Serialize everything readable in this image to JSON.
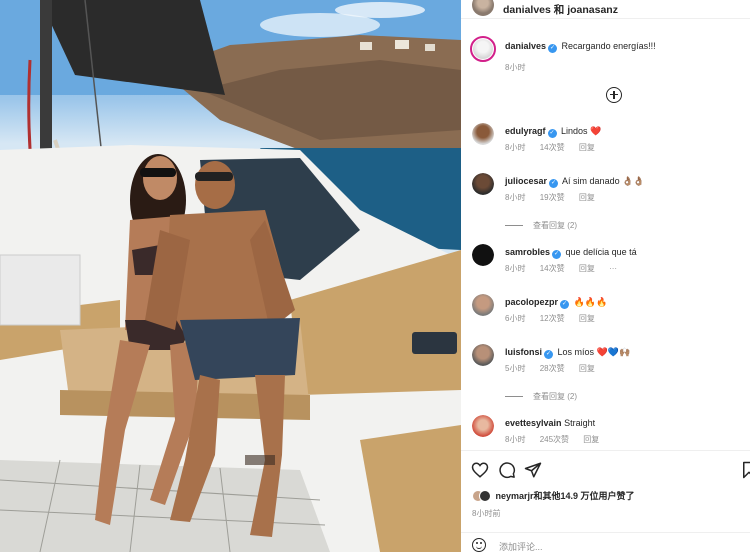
{
  "header": {
    "users": "danialves 和 joanasanz"
  },
  "caption": {
    "username": "danialves",
    "text": "Recargando energías!!!",
    "time": "8小时"
  },
  "comments": [
    {
      "username": "edulyragf",
      "verified": true,
      "text": "Lindos ❤️",
      "time": "8小时",
      "likes": "14次赞",
      "reply": "回复"
    },
    {
      "username": "juliocesar",
      "verified": true,
      "text": "Aí sim danado 👌🏽👌🏽",
      "time": "8小时",
      "likes": "19次赞",
      "reply": "回复",
      "view_replies": "查看回复 (2)"
    },
    {
      "username": "samrobles",
      "verified": true,
      "text": "que delícia que tá",
      "time": "8小时",
      "likes": "14次赞",
      "reply": "回复",
      "more": "···"
    },
    {
      "username": "pacolopezpr",
      "verified": true,
      "text": "🔥🔥🔥",
      "time": "6小时",
      "likes": "12次赞",
      "reply": "回复"
    },
    {
      "username": "luisfonsi",
      "verified": true,
      "text": "Los míos ❤️💙🙌🏽",
      "time": "5小时",
      "likes": "28次赞",
      "reply": "回复",
      "view_replies": "查看回复 (2)"
    },
    {
      "username": "evettesylvain",
      "verified": false,
      "text": "Straight",
      "time": "8小时",
      "likes": "245次赞",
      "reply": "回复"
    }
  ],
  "likes_summary": "neymarjr和其他14.9 万位用户赞了",
  "post_time": "8小时前",
  "add_comment_placeholder": "添加评论...",
  "colors": {
    "verified": "#3897f0",
    "secondary_text": "#8e8e8e",
    "ring": "#d2208a"
  }
}
